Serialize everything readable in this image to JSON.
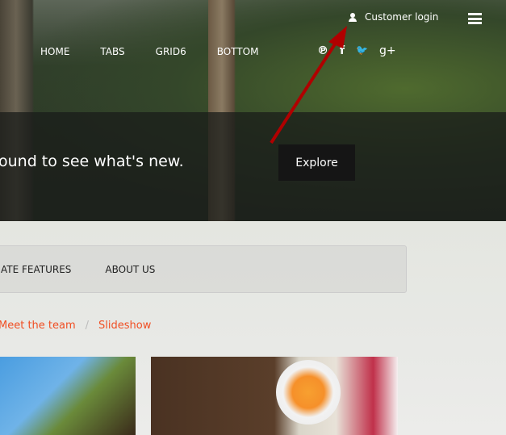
{
  "header": {
    "login_label": "Customer login"
  },
  "nav": {
    "items": [
      "HOME",
      "TABS",
      "GRID6",
      "BOTTOM"
    ]
  },
  "social": {
    "icons": [
      "pinterest-icon",
      "facebook-icon",
      "twitter-icon",
      "google-plus-icon"
    ],
    "glyphs": [
      "℗",
      "f",
      "🐦",
      "g+"
    ]
  },
  "hero": {
    "text": "ound to see what's new.",
    "button": "Explore"
  },
  "menu": {
    "items": [
      "ATE FEATURES",
      "ABOUT US"
    ]
  },
  "breadcrumb": {
    "items": [
      "Meet the team",
      "Slideshow"
    ],
    "separator": "/"
  },
  "colors": {
    "accent": "#f04e23",
    "annotation": "#b00000"
  }
}
